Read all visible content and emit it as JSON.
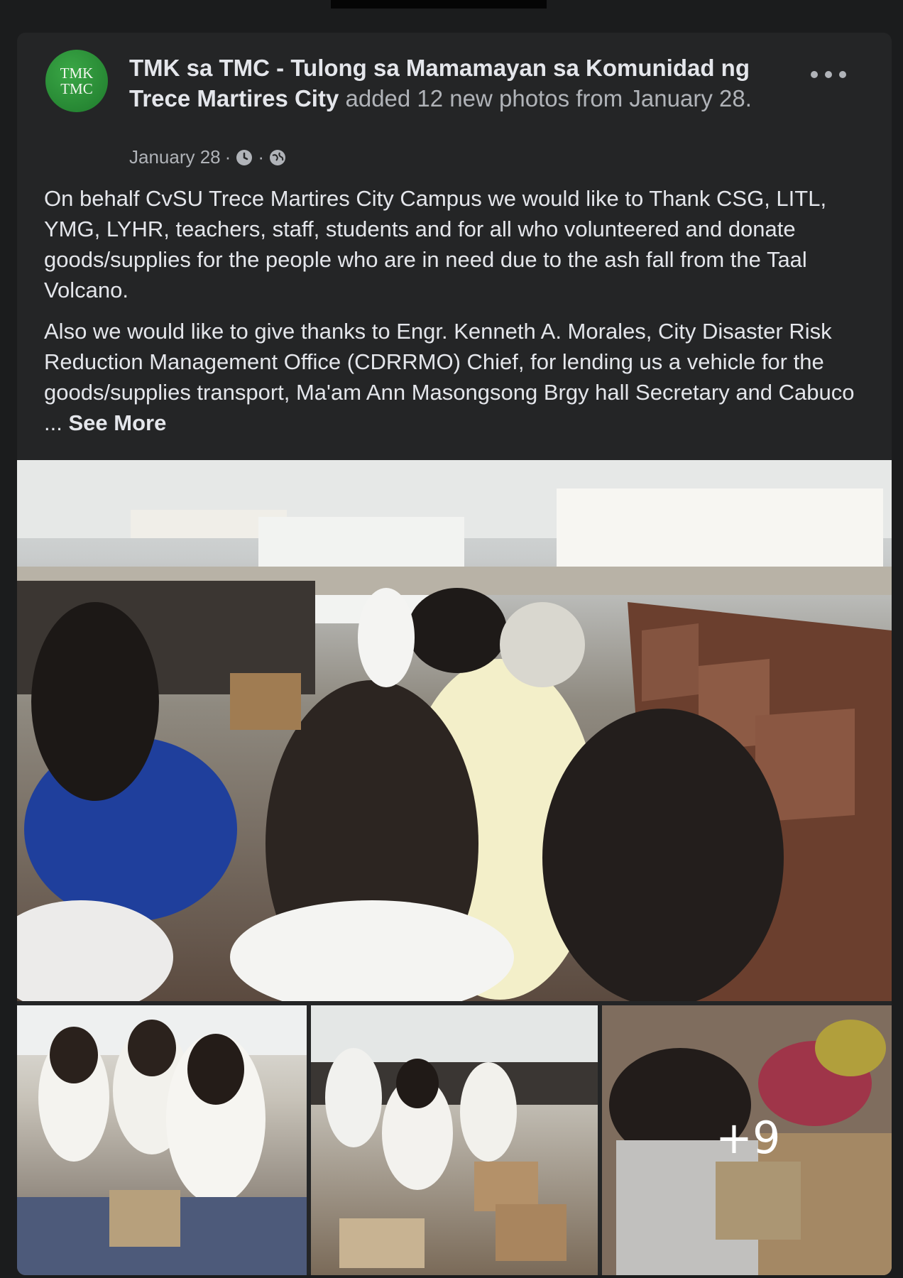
{
  "post": {
    "avatar": {
      "line1": "TMK",
      "line2": "TMC"
    },
    "page_name": "TMK sa TMC - Tulong sa Mamamayan sa Komunidad ng Trece Martires City",
    "action_text": "added 12 new photos from January 28.",
    "date": "January 28",
    "separator": "·",
    "paragraph1": "On behalf CvSU Trece Martires City Campus we would like to Thank CSG, LITL, YMG, LYHR, teachers, staff, students and for all who volunteered and donate goods/supplies for the people who are in need due to the ash fall from the Taal Volcano.",
    "paragraph2": "Also we would like to give thanks to Engr. Kenneth A. Morales, City Disaster Risk Reduction Management Office (CDRRMO) Chief, for lending us a vehicle for the goods/supplies transport, Ma'am Ann Masongsong Brgy hall Secretary and Cabuco ...",
    "see_more": "See More",
    "more_photos_label": "+9"
  },
  "colors": {
    "background": "#1b1c1d",
    "card": "#242526",
    "primary_text": "#e4e6eb",
    "secondary_text": "#b0b3b8",
    "avatar_green": "#2e8f3a"
  },
  "icons": {
    "options": "more-horizontal-icon",
    "clock": "clock-icon",
    "privacy": "globe-icon"
  }
}
